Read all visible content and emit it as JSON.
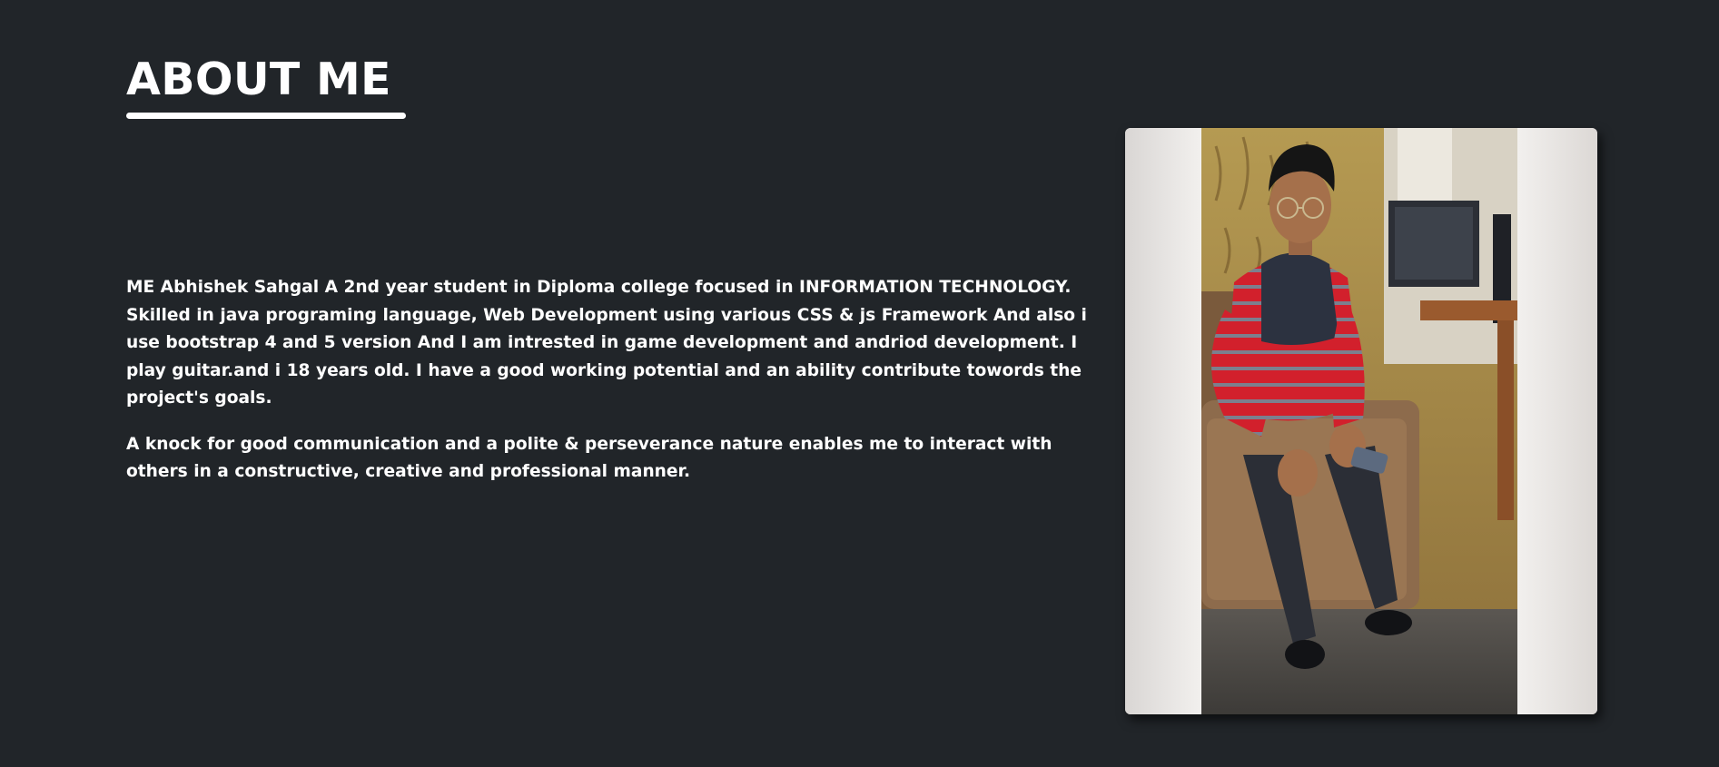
{
  "about": {
    "heading": "ABOUT ME",
    "paragraphs": [
      "ME Abhishek Sahgal A 2nd year student in Diploma college focused in INFORMATION TECHNOLOGY. Skilled in java programing language, Web Development using various CSS & js Framework And also i use bootstrap 4 and 5 version And I am intrested in game development and andriod development. I play guitar.and i 18 years old. I have a good working potential and an ability contribute towords the project's goals.",
      "A knock for good communication and a polite & perseverance nature enables me to interact with others in a constructive, creative and professional manner."
    ]
  },
  "colors": {
    "background": "#212529",
    "text": "#ffffff"
  }
}
